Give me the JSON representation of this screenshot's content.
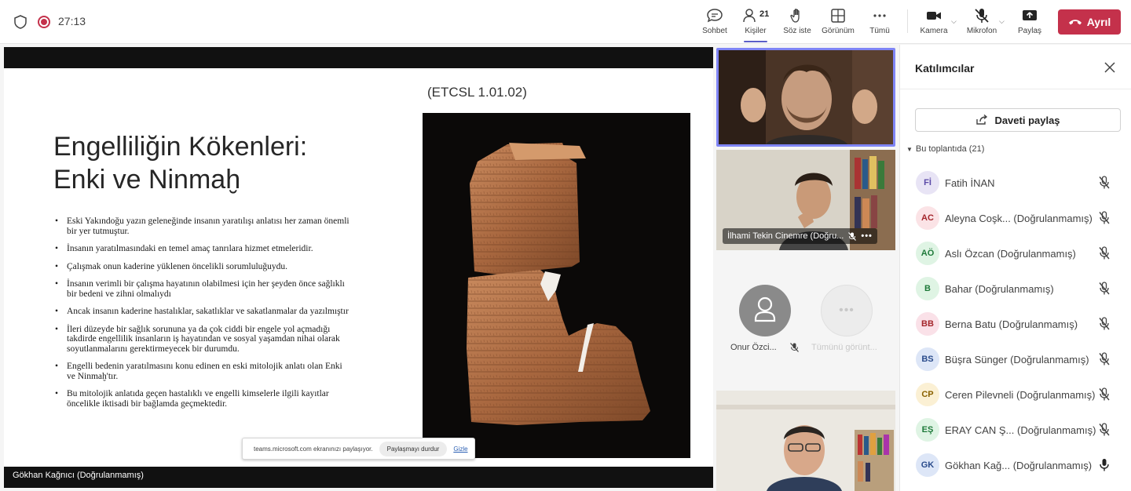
{
  "status": {
    "timer": "27:13"
  },
  "toolbar": {
    "chat": "Sohbet",
    "people": "Kişiler",
    "people_count": "21",
    "raise_hand": "Söz iste",
    "view": "Görünüm",
    "more": "Tümü",
    "camera": "Kamera",
    "mic": "Mikrofon",
    "share": "Paylaş",
    "leave": "Ayrıl"
  },
  "slide": {
    "reference": "(ETCSL 1.01.02)",
    "title_line1": "Engelliliğin Kökenleri:",
    "title_line2": "Enki ve Ninmaḫ",
    "bullets": [
      "Eski Yakındoğu yazın geleneğinde insanın yaratılışı anlatısı her zaman önemli bir yer tutmuştur.",
      "İnsanın yaratılmasındaki en temel amaç tanrılara hizmet etmeleridir.",
      "Çalışmak onun kaderine yüklenen öncelikli sorumluluğuydu.",
      "İnsanın verimli bir çalışma hayatının olabilmesi için her şeyden önce sağlıklı bir bedeni ve zihni olmalıydı",
      "Ancak insanın kaderine hastalıklar, sakatlıklar ve sakatlanmalar da yazılmıştır",
      "İleri düzeyde bir sağlık sorununa ya da çok ciddi bir engele yol açmadığı takdirde engellilik insanların iş hayatından ve sosyal yaşamdan nihai olarak soyutlanmalarını gerektirmeyecek bir durumdu.",
      "Engelli bedenin yaratılmasını konu edinen en eski mitolojik anlatı olan Enki ve Ninmaḫ'tır.",
      "Bu mitolojik anlatıda geçen hastalıklı ve engelli kimselerle ilgili kayıtlar öncelikle iktisadi bir bağlamda geçmektedir."
    ]
  },
  "share_bar": {
    "message": "teams.microsoft.com ekranınızı paylaşıyor.",
    "stop": "Paylaşmayı durdur",
    "hide": "Gizle"
  },
  "presenter": {
    "name": "Gökhan Kağnıcı (Doğrulanmamış)"
  },
  "tiles": {
    "tile2_name": "İlhami Tekin Cinemre (Doğru...",
    "tile3_name": "Onur Özci...",
    "tile3_more": "Tümünü görünt..."
  },
  "panel": {
    "title": "Katılımcılar",
    "invite": "Daveti paylaş",
    "section": "Bu toplantıda (21)",
    "participants": [
      {
        "initials": "Fİ",
        "name": "Fatih İNAN",
        "bg": "#e8e4f5",
        "fg": "#5b4aa8",
        "mic": "muted"
      },
      {
        "initials": "AC",
        "name": "Aleyna Coşk... (Doğrulanmamış)",
        "bg": "#fbe3e6",
        "fg": "#a4262c",
        "mic": "muted"
      },
      {
        "initials": "AÖ",
        "name": "Aslı Özcan (Doğrulanmamış)",
        "bg": "#dff4e4",
        "fg": "#1f7a3a",
        "mic": "muted"
      },
      {
        "initials": "B",
        "name": "Bahar (Doğrulanmamış)",
        "bg": "#dff4e4",
        "fg": "#1f7a3a",
        "mic": "muted"
      },
      {
        "initials": "BB",
        "name": "Berna Batu (Doğrulanmamış)",
        "bg": "#fae1e8",
        "fg": "#a4262c",
        "mic": "muted"
      },
      {
        "initials": "BS",
        "name": "Büşra Sünger (Doğrulanmamış)",
        "bg": "#dde6f7",
        "fg": "#2b4c8c",
        "mic": "muted"
      },
      {
        "initials": "CP",
        "name": "Ceren Pilevneli (Doğrulanmamış)",
        "bg": "#fbf0d4",
        "fg": "#8a6100",
        "mic": "muted"
      },
      {
        "initials": "EŞ",
        "name": "ERAY CAN Ş... (Doğrulanmamış)",
        "bg": "#dff4e4",
        "fg": "#1f7a3a",
        "mic": "muted"
      },
      {
        "initials": "GK",
        "name": "Gökhan Kağ... (Doğrulanmamış)",
        "bg": "#dde6f7",
        "fg": "#2b4c8c",
        "mic": "on"
      }
    ]
  },
  "colors": {
    "accent": "#5b5fc7",
    "leave": "#c4314b"
  }
}
